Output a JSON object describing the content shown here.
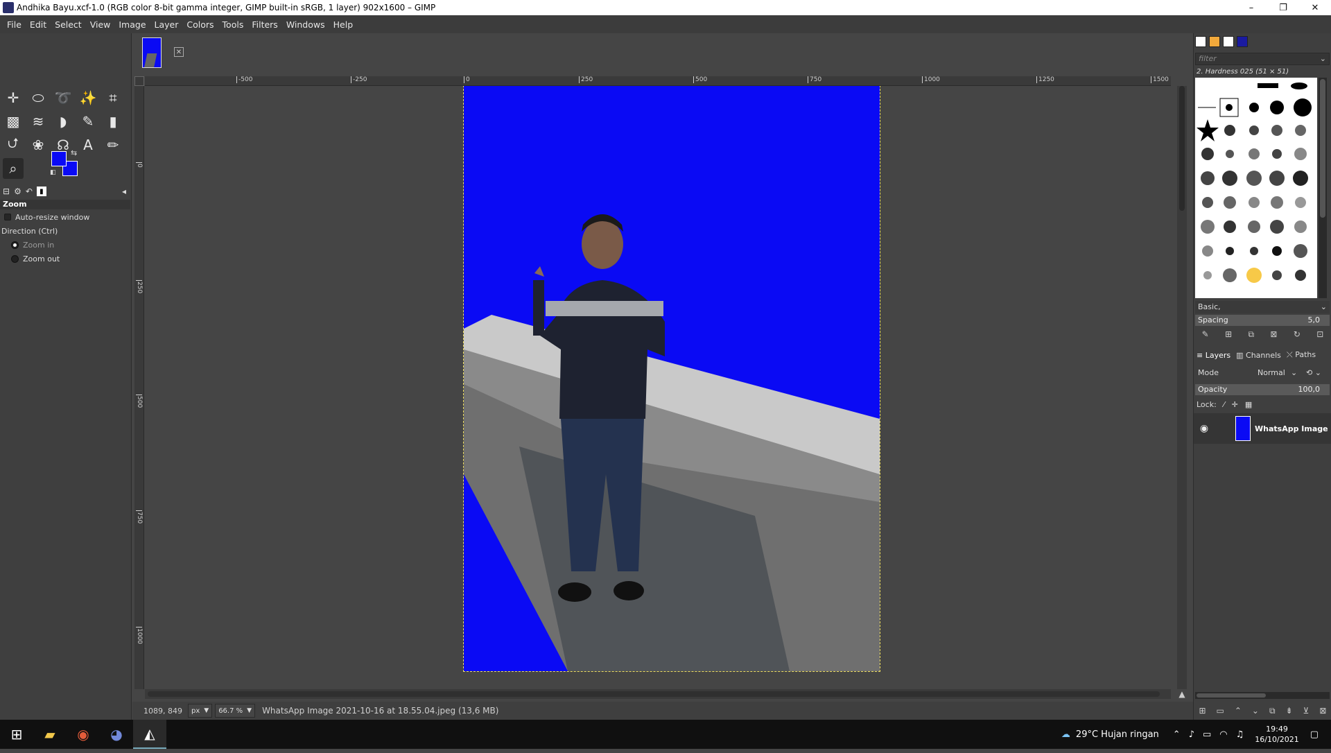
{
  "window": {
    "title": "Andhika Bayu.xcf-1.0 (RGB color 8-bit gamma integer, GIMP built-in sRGB, 1 layer) 902x1600 – GIMP",
    "controls": [
      "–",
      "❐",
      "✕"
    ]
  },
  "menu": [
    "File",
    "Edit",
    "Select",
    "View",
    "Image",
    "Layer",
    "Colors",
    "Tools",
    "Filters",
    "Windows",
    "Help"
  ],
  "colors": {
    "foreground": "#0a0af4",
    "background": "#0a0af4",
    "canvas_bg": "#454545",
    "selection": "#f0e060"
  },
  "tools": [
    {
      "name": "move-tool-icon",
      "glyph": "✛"
    },
    {
      "name": "ellipse-select-icon",
      "glyph": "⬭"
    },
    {
      "name": "free-select-icon",
      "glyph": "➰"
    },
    {
      "name": "fuzzy-select-icon",
      "glyph": "✨"
    },
    {
      "name": "crop-tool-icon",
      "glyph": "⌗"
    },
    {
      "name": "unified-transform-icon",
      "glyph": "▩"
    },
    {
      "name": "warp-transform-icon",
      "glyph": "≋"
    },
    {
      "name": "bucket-fill-icon",
      "glyph": "◗"
    },
    {
      "name": "paintbrush-icon",
      "glyph": "✎"
    },
    {
      "name": "eraser-icon",
      "glyph": "▮"
    },
    {
      "name": "clone-tool-icon",
      "glyph": "⮍"
    },
    {
      "name": "smudge-tool-icon",
      "glyph": "❀"
    },
    {
      "name": "paths-tool-icon",
      "glyph": "☊"
    },
    {
      "name": "text-tool-icon",
      "glyph": "A"
    },
    {
      "name": "color-picker-icon",
      "glyph": "✏"
    },
    {
      "name": "zoom-tool-icon",
      "glyph": "⌕"
    }
  ],
  "tool_options": {
    "title": "Zoom",
    "auto_resize": "Auto-resize window",
    "direction_label": "Direction  (Ctrl)",
    "zoom_in": "Zoom in",
    "zoom_out": "Zoom out"
  },
  "rulers": {
    "h_labels": [
      "-500",
      "-250",
      "0",
      "250",
      "500",
      "750",
      "1000",
      "1250",
      "1500"
    ],
    "v_labels": [
      "0",
      "250",
      "500",
      "750",
      "1000",
      "1250",
      "1500"
    ]
  },
  "status": {
    "coords": "1089, 849",
    "unit": "px",
    "zoom": "66.7 %",
    "file_info": "WhatsApp Image 2021-10-16 at 18.55.04.jpeg (13,6 MB)"
  },
  "brushes": {
    "filter_placeholder": "filter",
    "current_brush": "2. Hardness 025 (51 × 51)",
    "preset": "Basic,",
    "spacing_label": "Spacing",
    "spacing_value": "5,0"
  },
  "layers": {
    "tab_layers": "Layers",
    "tab_channels": "Channels",
    "tab_paths": "Paths",
    "mode_label": "Mode",
    "mode_value": "Normal",
    "opacity_label": "Opacity",
    "opacity_value": "100,0",
    "lock_label": "Lock:",
    "layer_name": "WhatsApp Image"
  },
  "taskbar": {
    "weather": "29°C  Hujan ringan",
    "time": "19:49",
    "date": "16/10/2021"
  }
}
